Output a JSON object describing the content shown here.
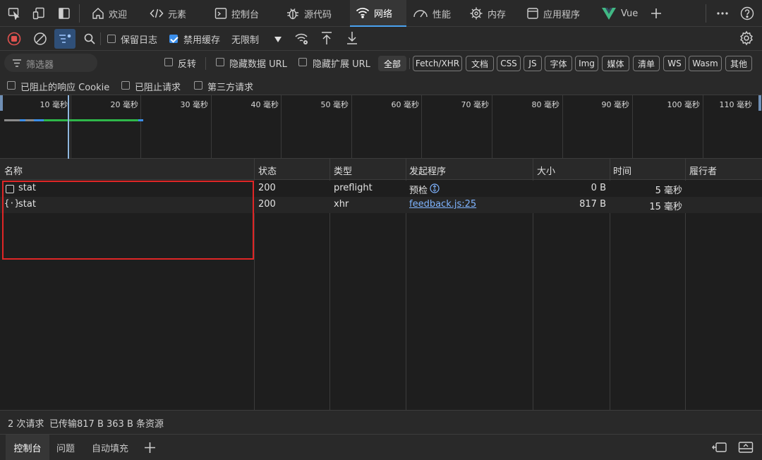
{
  "tabs": [
    {
      "label": "欢迎",
      "icon": "home-icon"
    },
    {
      "label": "元素",
      "icon": "code-icon"
    },
    {
      "label": "控制台",
      "icon": "console-icon"
    },
    {
      "label": "源代码",
      "icon": "bug-icon"
    },
    {
      "label": "网络",
      "icon": "wifi-icon",
      "active": true
    },
    {
      "label": "性能",
      "icon": "gauge-icon"
    },
    {
      "label": "内存",
      "icon": "memory-icon"
    },
    {
      "label": "应用程序",
      "icon": "app-icon"
    },
    {
      "label": "Vue",
      "icon": "vue-icon"
    }
  ],
  "toolbar": {
    "preserve_log": "保留日志",
    "disable_cache": "禁用缓存",
    "throttle": "无限制"
  },
  "filter": {
    "placeholder": "筛选器",
    "invert": "反转",
    "hide_data_url": "隐藏数据 URL",
    "hide_ext_url": "隐藏扩展 URL",
    "types": [
      "全部",
      "Fetch/XHR",
      "文档",
      "CSS",
      "JS",
      "字体",
      "Img",
      "媒体",
      "清单",
      "WS",
      "Wasm",
      "其他"
    ],
    "blocked_cookies": "已阻止的响应 Cookie",
    "blocked_requests": "已阻止请求",
    "third_party": "第三方请求"
  },
  "timeline": {
    "ticks": [
      "10 毫秒",
      "20 毫秒",
      "30 毫秒",
      "40 毫秒",
      "50 毫秒",
      "60 毫秒",
      "70 毫秒",
      "80 毫秒",
      "90 毫秒",
      "100 毫秒",
      "110 毫秒"
    ]
  },
  "table": {
    "columns": [
      "名称",
      "状态",
      "类型",
      "发起程序",
      "大小",
      "时间",
      "履行者"
    ],
    "rows": [
      {
        "name": "stat",
        "status": "200",
        "type": "preflight",
        "initiator": "预检",
        "size": "0 B",
        "time": "5 毫秒",
        "icon": "document-icon"
      },
      {
        "name": "stat",
        "status": "200",
        "type": "xhr",
        "initiator": "feedback.js:25",
        "size": "817 B",
        "time": "15 毫秒",
        "icon": "xhr-icon"
      }
    ]
  },
  "status": {
    "requests": "2 次请求",
    "transferred": "已传输817 B",
    "resources": "363 B 条资源"
  },
  "drawer": {
    "tabs": [
      "控制台",
      "问题",
      "自动填充"
    ]
  },
  "colors": {
    "accent": "#4aa3f0",
    "highlight": "#e02626",
    "record": "#e0524f"
  }
}
